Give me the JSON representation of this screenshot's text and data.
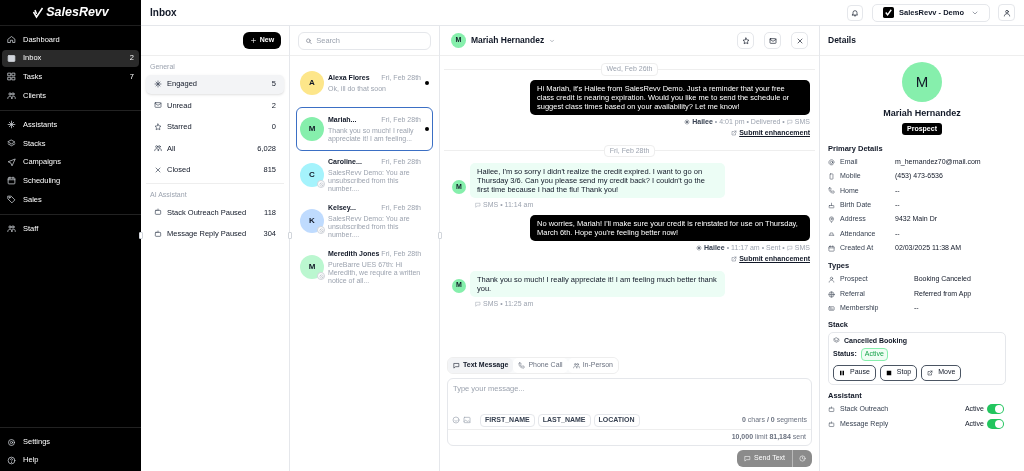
{
  "brand": "SalesRevv",
  "nav": [
    {
      "label": "Dashboard",
      "selected": false
    },
    {
      "label": "Inbox",
      "selected": true,
      "count": "2"
    },
    {
      "label": "Tasks",
      "selected": false,
      "count": "7"
    },
    {
      "label": "Clients",
      "selected": false
    },
    {
      "label": "Assistants",
      "selected": false,
      "group_start": true
    },
    {
      "label": "Stacks",
      "selected": false
    },
    {
      "label": "Campaigns",
      "selected": false
    },
    {
      "label": "Scheduling",
      "selected": false
    },
    {
      "label": "Sales",
      "selected": false
    },
    {
      "label": "Staff",
      "selected": false,
      "group_start": true
    }
  ],
  "nav_bottom": [
    {
      "label": "Settings"
    },
    {
      "label": "Help"
    }
  ],
  "page_title": "Inbox",
  "workspace": "SalesRevv - Demo",
  "new_button": "New",
  "filter_groups": [
    {
      "title": "General",
      "items": [
        {
          "label": "Engaged",
          "count": "5",
          "selected": true
        },
        {
          "label": "Unread",
          "count": "2",
          "selected": false
        },
        {
          "label": "Starred",
          "count": "0",
          "selected": false
        },
        {
          "label": "All",
          "count": "6,028",
          "selected": false
        },
        {
          "label": "Closed",
          "count": "815",
          "selected": false
        }
      ]
    },
    {
      "title": "AI Assistant",
      "items": [
        {
          "label": "Stack Outreach Paused",
          "count": "118",
          "selected": false
        },
        {
          "label": "Message Reply Paused",
          "count": "304",
          "selected": false
        }
      ]
    }
  ],
  "search": {
    "placeholder": "Search"
  },
  "conversations": [
    {
      "initial": "A",
      "name": "Alexa Flores",
      "date": "Fri, Feb 28th",
      "preview": "Ok, ill do that soon",
      "color": "#fde68a",
      "unread": true,
      "unsubscribed": false,
      "selected": false
    },
    {
      "initial": "M",
      "name": "Mariah...",
      "date": "Fri, Feb 28th",
      "preview": "Thank you so much! I really appreciate it! I am feeling...",
      "color": "#86efac",
      "unread": true,
      "unsubscribed": false,
      "selected": true
    },
    {
      "initial": "C",
      "name": "Caroline...",
      "date": "Fri, Feb 28th",
      "preview": "SalesRevv Demo: You are unsubscribed from this number....",
      "color": "#a5f3fc",
      "unread": false,
      "unsubscribed": true,
      "selected": false
    },
    {
      "initial": "K",
      "name": "Kelsey...",
      "date": "Fri, Feb 28th",
      "preview": "SalesRevv Demo: You are unsubscribed from this number....",
      "color": "#bfdbfe",
      "unread": false,
      "unsubscribed": true,
      "selected": false
    },
    {
      "initial": "M",
      "name": "Meredith Jones",
      "date": "Fri, Feb 28th",
      "preview": "PureBarre UES 67th: Hi Meredith, we require a written notice of all...",
      "color": "#bbf7d0",
      "unread": false,
      "unsubscribed": true,
      "selected": false
    }
  ],
  "chat": {
    "initial": "M",
    "name": "Mariah Hernandez",
    "messages": [
      {
        "kind": "date",
        "text": "Wed, Feb 26th"
      },
      {
        "kind": "outbound",
        "text": "Hi Mariah, it's Hailee from SalesRevv Demo. Just a reminder that your free class credit is nearing expiration. Would you like me to send the schedule or suggest class times based on your availability? Let me know!",
        "sender": "Hailee",
        "meta": "• 4:01 pm • Delivered •",
        "channel": "SMS",
        "link": "Submit enhancement"
      },
      {
        "kind": "date",
        "text": "Fri, Feb 28th"
      },
      {
        "kind": "inbound",
        "initial": "M",
        "text": "Hailee, I'm so sorry I didn't realize the credit expired. I want to go on Thursday 3/6. Can you please send my credit back? I couldn't go the first time because I had the flu! Thank you!",
        "channel": "SMS",
        "meta": "• 11:14 am"
      },
      {
        "kind": "outbound",
        "text": "No worries, Mariah! I'll make sure your credit is reinstated for use on Thursday, March 6th. Hope you're feeling better now!",
        "sender": "Hailee",
        "meta": "• 11:17 am • Sent •",
        "channel": "SMS",
        "link": "Submit enhancement"
      },
      {
        "kind": "inbound",
        "initial": "M",
        "text": "Thank you so much! I really appreciate it! I am feeling much better thank you.",
        "channel": "SMS",
        "meta": "• 11:25 am"
      }
    ],
    "modes": [
      {
        "label": "Text Message",
        "selected": true
      },
      {
        "label": "Phone Call",
        "selected": false
      },
      {
        "label": "In-Person",
        "selected": false
      }
    ],
    "composer": {
      "placeholder": "Type your message...",
      "chips": [
        "FIRST_NAME",
        "LAST_NAME",
        "LOCATION"
      ],
      "counter": "**0** chars **/** **0** segments",
      "limits": "**10,000** limit **81,184** sent"
    },
    "send": {
      "label": "Send Text",
      "disabled": true
    }
  },
  "details": {
    "title": "Details",
    "initial": "M",
    "name": "Mariah Hernandez",
    "badge": "Prospect",
    "primary_title": "Primary Details",
    "primary": [
      {
        "label": "Email",
        "value": "m_hernandez70@mail.com"
      },
      {
        "label": "Mobile",
        "value": "(453) 473-6536"
      },
      {
        "label": "Home",
        "value": "--"
      },
      {
        "label": "Birth Date",
        "value": "--"
      },
      {
        "label": "Address",
        "value": "9432 Main Dr"
      },
      {
        "label": "Attendance",
        "value": "--"
      },
      {
        "label": "Created At",
        "value": "02/03/2025 11:38 AM"
      }
    ],
    "types_title": "Types",
    "types": [
      {
        "label": "Prospect",
        "value": "Booking Canceled"
      },
      {
        "label": "Referral",
        "value": "Referred from App"
      },
      {
        "label": "Membership",
        "value": "--"
      }
    ],
    "stack_title": "Stack",
    "stack": {
      "name": "Cancelled Booking",
      "status_label": "Status:",
      "status": "Active",
      "buttons": [
        "Pause",
        "Stop",
        "Move"
      ]
    },
    "assistant_title": "Assistant",
    "assistants": [
      {
        "label": "Stack Outreach",
        "status": "Active",
        "on": true
      },
      {
        "label": "Message Reply",
        "status": "Active",
        "on": true
      }
    ]
  }
}
